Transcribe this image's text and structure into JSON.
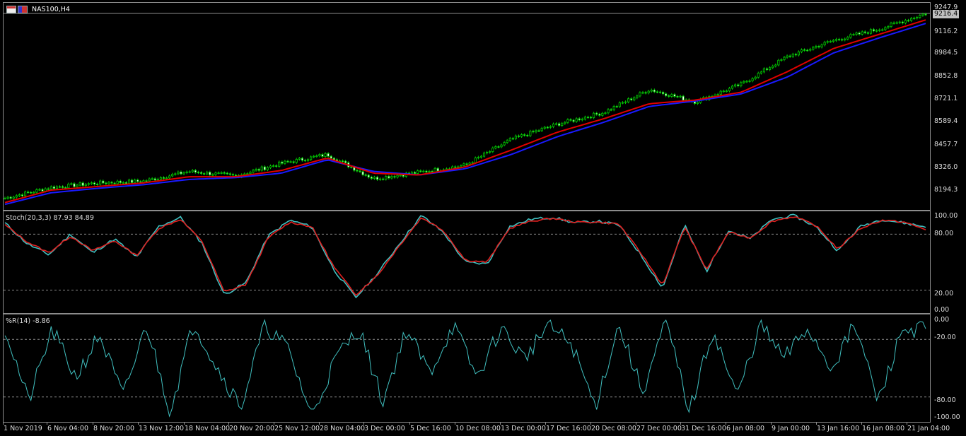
{
  "window": {
    "symbol": "NAS100,H4"
  },
  "main_chart": {
    "current_price": "9216.4",
    "price_axis": [
      "9247.9",
      "9116.2",
      "8984.5",
      "8852.8",
      "8721.1",
      "8589.4",
      "8457.7",
      "8326.0",
      "8194.3"
    ],
    "ylim": [
      8130,
      9260
    ]
  },
  "stochastic": {
    "label": "Stoch(20,3,3) 87.93 84.89",
    "axis": [
      "100.00",
      "80.00",
      "20.00",
      "0.00"
    ]
  },
  "williams": {
    "label": "%R(14) -8.86",
    "axis": [
      "0.00",
      "-20.00",
      "-80.00",
      "-100.00"
    ]
  },
  "time_axis": [
    "1 Nov 2019",
    "6 Nov 04:00",
    "8 Nov 20:00",
    "13 Nov 12:00",
    "18 Nov 04:00",
    "20 Nov 20:00",
    "25 Nov 12:00",
    "28 Nov 04:00",
    "3 Dec 00:00",
    "5 Dec 16:00",
    "10 Dec 08:00",
    "13 Dec 00:00",
    "17 Dec 16:00",
    "20 Dec 08:00",
    "27 Dec 00:00",
    "31 Dec 16:00",
    "6 Jan 08:00",
    "9 Jan 00:00",
    "13 Jan 16:00",
    "16 Jan 08:00",
    "21 Jan 04:00"
  ],
  "colors": {
    "background": "#000000",
    "candle": "#00cc00",
    "ma_fast": "#e00000",
    "ma_slow": "#1a1aff",
    "stoch_main": "#40c0c0",
    "stoch_signal": "#e02020",
    "wr": "#40c0c0",
    "grid": "#8c8c8c"
  },
  "chart_data": [
    {
      "type": "line",
      "title": "NAS100,H4",
      "x": [
        "1 Nov 2019",
        "6 Nov 04:00",
        "8 Nov 20:00",
        "13 Nov 12:00",
        "18 Nov 04:00",
        "20 Nov 20:00",
        "25 Nov 12:00",
        "28 Nov 04:00",
        "3 Dec 00:00",
        "5 Dec 16:00",
        "10 Dec 08:00",
        "13 Dec 00:00",
        "17 Dec 16:00",
        "20 Dec 08:00",
        "27 Dec 00:00",
        "31 Dec 16:00",
        "6 Jan 08:00",
        "9 Jan 00:00",
        "13 Jan 16:00",
        "16 Jan 08:00",
        "21 Jan 04:00"
      ],
      "series": [
        {
          "name": "Close",
          "values": [
            8180,
            8240,
            8265,
            8275,
            8330,
            8305,
            8375,
            8425,
            8290,
            8325,
            8365,
            8510,
            8595,
            8660,
            8790,
            8720,
            8820,
            8975,
            9065,
            9130,
            9216
          ]
        },
        {
          "name": "MA fast",
          "values": [
            8155,
            8225,
            8245,
            8265,
            8300,
            8300,
            8335,
            8405,
            8320,
            8310,
            8355,
            8450,
            8550,
            8625,
            8710,
            8730,
            8775,
            8890,
            9020,
            9100,
            9180
          ]
        },
        {
          "name": "MA slow",
          "values": [
            8145,
            8210,
            8235,
            8255,
            8285,
            8295,
            8320,
            8395,
            8330,
            8310,
            8345,
            8425,
            8525,
            8605,
            8695,
            8725,
            8765,
            8860,
            8995,
            9080,
            9160
          ]
        }
      ],
      "ylim": [
        8130,
        9260
      ]
    },
    {
      "type": "line",
      "title": "Stoch(20,3,3) 87.93 84.89",
      "series": [
        {
          "name": "Main",
          "values": [
            92,
            70,
            58,
            80,
            60,
            75,
            55,
            88,
            98,
            70,
            15,
            28,
            78,
            95,
            88,
            42,
            12,
            38,
            70,
            100,
            82,
            50,
            48,
            88,
            96,
            98,
            92,
            94,
            90,
            58,
            22,
            90,
            40,
            84,
            75,
            96,
            100,
            88,
            62,
            88,
            96,
            92,
            87.93
          ]
        },
        {
          "name": "Signal",
          "values": [
            90,
            72,
            60,
            78,
            62,
            73,
            57,
            86,
            96,
            72,
            18,
            26,
            76,
            93,
            88,
            45,
            15,
            36,
            68,
            98,
            84,
            52,
            50,
            86,
            94,
            97,
            93,
            93,
            91,
            60,
            25,
            88,
            42,
            82,
            76,
            94,
            99,
            89,
            64,
            86,
            95,
            93,
            84.89
          ]
        }
      ],
      "ylim": [
        0,
        100
      ]
    },
    {
      "type": "line",
      "title": "%R(14) -8.86",
      "values": [
        -8,
        -85,
        -10,
        -60,
        -15,
        -80,
        -5,
        -95,
        -2,
        -50,
        -90,
        -5,
        -30,
        -100,
        -40,
        -8,
        -85,
        -10,
        -55,
        -5,
        -60,
        -8,
        -40,
        -5,
        -25,
        -90,
        -5,
        -75,
        -2,
        -95,
        -10,
        -80,
        -5,
        -40,
        -8,
        -50,
        -5,
        -85,
        -10,
        -8.86
      ],
      "ylim": [
        -100,
        0
      ]
    }
  ]
}
